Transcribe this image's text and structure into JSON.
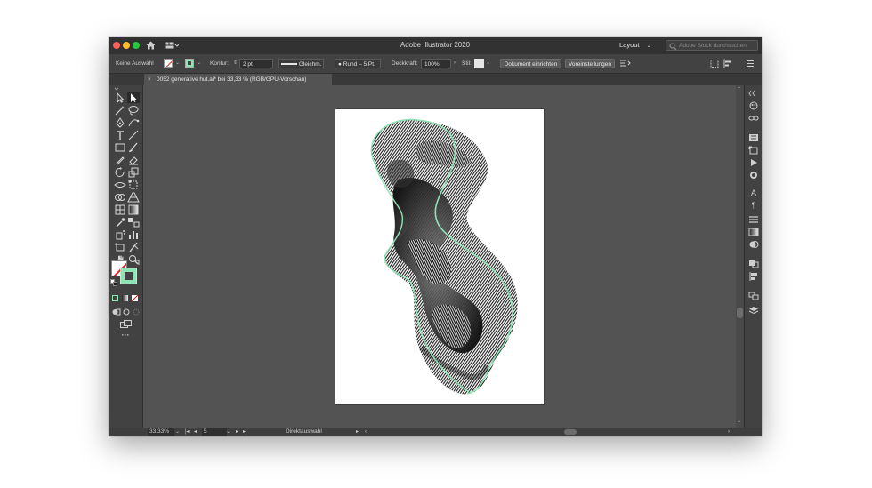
{
  "window": {
    "title": "Adobe Illustrator 2020"
  },
  "titlebar": {
    "workspace": "Layout",
    "stock_search_placeholder": "Adobe Stock durchsuchen"
  },
  "control_bar": {
    "selection_label": "Keine Auswahl",
    "stroke_label": "Kontur:",
    "stroke_weight": "2 pt",
    "stroke_profile": "Gleichm.",
    "brush": "Rund – 5 Pt.",
    "opacity_label": "Deckkraft:",
    "opacity_value": "100%",
    "style_label": "Stil:",
    "document_setup_button": "Dokument einrichten",
    "preferences_button": "Voreinstellungen",
    "stroke_color": "#8ee4b5"
  },
  "document_tab": {
    "close": "×",
    "name": "0052 generative hut.ai* bei 33,33 % (RGB/GPU-Vorschau)"
  },
  "status_bar": {
    "zoom": "33,33%",
    "artboard_number": "5",
    "tool_name": "Direktauswahl"
  },
  "toolbar": {
    "more_tools": "···"
  },
  "colors": {
    "accent_green": "#8ee4b5",
    "ui_dark": "#535353",
    "panel": "#424242"
  }
}
